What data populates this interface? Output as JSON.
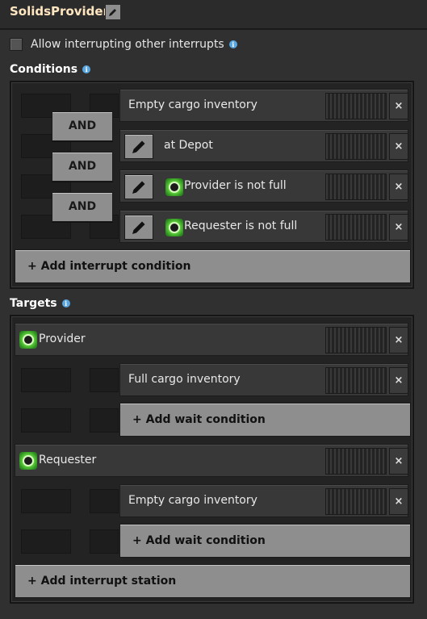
{
  "header": {
    "title": "SolidsProvider",
    "edit_icon": "pencil-icon"
  },
  "allow_interrupt": {
    "label": "Allow interrupting other interrupts",
    "checked": false
  },
  "conditions": {
    "title": "Conditions",
    "connectors": [
      "AND",
      "AND",
      "AND"
    ],
    "rows": [
      {
        "label": "Empty cargo inventory",
        "has_edit": false,
        "icon": null
      },
      {
        "label": "at Depot",
        "has_edit": true,
        "icon": null
      },
      {
        "label": "Provider is not full",
        "has_edit": true,
        "icon": "signal-icon"
      },
      {
        "label": "Requester is not full",
        "has_edit": true,
        "icon": "signal-icon"
      }
    ],
    "add_label": "+ Add interrupt condition",
    "close": "×"
  },
  "targets": {
    "title": "Targets",
    "stations": [
      {
        "name": "Provider",
        "condition": "Full cargo inventory",
        "add_wait": "+ Add wait condition"
      },
      {
        "name": "Requester",
        "condition": "Empty cargo inventory",
        "add_wait": "+ Add wait condition"
      }
    ],
    "add_station": "+ Add interrupt station"
  }
}
